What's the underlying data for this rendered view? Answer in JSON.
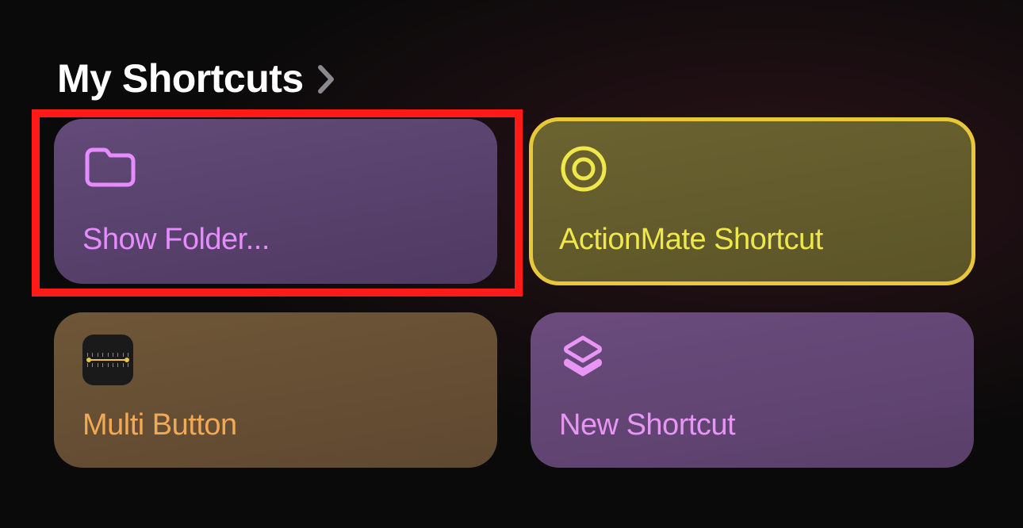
{
  "header": {
    "title": "My Shortcuts"
  },
  "shortcuts": [
    {
      "label": "Show Folder...",
      "icon": "folder-icon",
      "highlighted": "red"
    },
    {
      "label": "ActionMate Shortcut",
      "icon": "target-icon",
      "highlighted": "yellow"
    },
    {
      "label": "Multi Button",
      "icon": "ruler-app-icon"
    },
    {
      "label": "New Shortcut",
      "icon": "shortcuts-icon"
    }
  ]
}
